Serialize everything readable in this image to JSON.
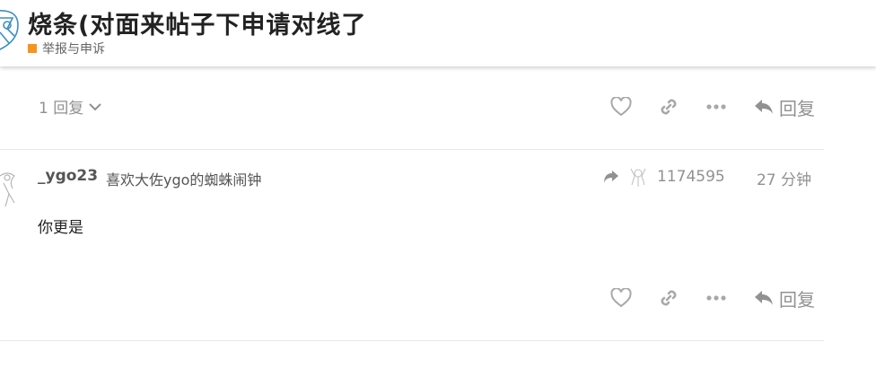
{
  "topic": {
    "title": "烧条(对面来帖子下申请对线了",
    "category": "举报与申诉",
    "category_color": "#F7941D"
  },
  "first_post_actions": {
    "replies_count_label": "1 回复",
    "reply_label": "回复"
  },
  "post": {
    "username": "_ygo23",
    "user_title": "喜欢大佐ygo的蜘蛛闹钟",
    "reply_to_user": "1174595",
    "time": "27 分钟",
    "body": "你更是",
    "reply_label": "回复"
  }
}
